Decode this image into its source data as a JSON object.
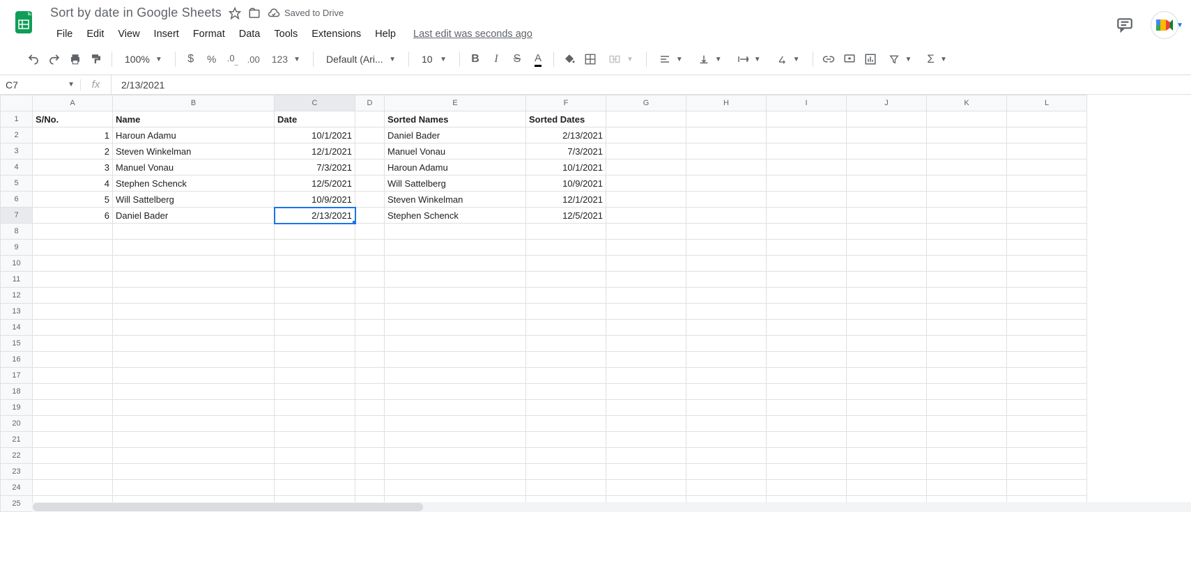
{
  "doc": {
    "title": "Sort by date in Google Sheets",
    "drive_status": "Saved to Drive",
    "last_edit": "Last edit was seconds ago"
  },
  "menus": [
    "File",
    "Edit",
    "View",
    "Insert",
    "Format",
    "Data",
    "Tools",
    "Extensions",
    "Help"
  ],
  "toolbar": {
    "zoom": "100%",
    "font_name": "Default (Ari...",
    "font_size": "10",
    "number_format": "123"
  },
  "namebox": "C7",
  "formula": "2/13/2021",
  "columns": [
    "A",
    "B",
    "C",
    "D",
    "E",
    "F",
    "G",
    "H",
    "I",
    "J",
    "K",
    "L"
  ],
  "col_widths": [
    "colA",
    "colB",
    "colC",
    "colD",
    "colE",
    "colF",
    "colrest",
    "colrest",
    "colrest",
    "colrest",
    "colrest",
    "colrest"
  ],
  "row_count": 25,
  "selected": {
    "row": 7,
    "col": 3
  },
  "headers": {
    "A1": "S/No.",
    "B1": "Name",
    "C1": "Date",
    "E1": "Sorted Names",
    "F1": "Sorted Dates"
  },
  "data_rows": [
    {
      "sn": "1",
      "name": "Haroun Adamu",
      "date": "10/1/2021",
      "sname": "Daniel Bader",
      "sdate": "2/13/2021"
    },
    {
      "sn": "2",
      "name": "Steven Winkelman",
      "date": "12/1/2021",
      "sname": "Manuel Vonau",
      "sdate": "7/3/2021"
    },
    {
      "sn": "3",
      "name": "Manuel Vonau",
      "date": "7/3/2021",
      "sname": "Haroun Adamu",
      "sdate": "10/1/2021"
    },
    {
      "sn": "4",
      "name": "Stephen Schenck",
      "date": "12/5/2021",
      "sname": "Will Sattelberg",
      "sdate": "10/9/2021"
    },
    {
      "sn": "5",
      "name": "Will Sattelberg",
      "date": "10/9/2021",
      "sname": "Steven Winkelman",
      "sdate": "12/1/2021"
    },
    {
      "sn": "6",
      "name": "Daniel Bader",
      "date": "2/13/2021",
      "sname": "Stephen Schenck",
      "sdate": "12/5/2021"
    }
  ]
}
